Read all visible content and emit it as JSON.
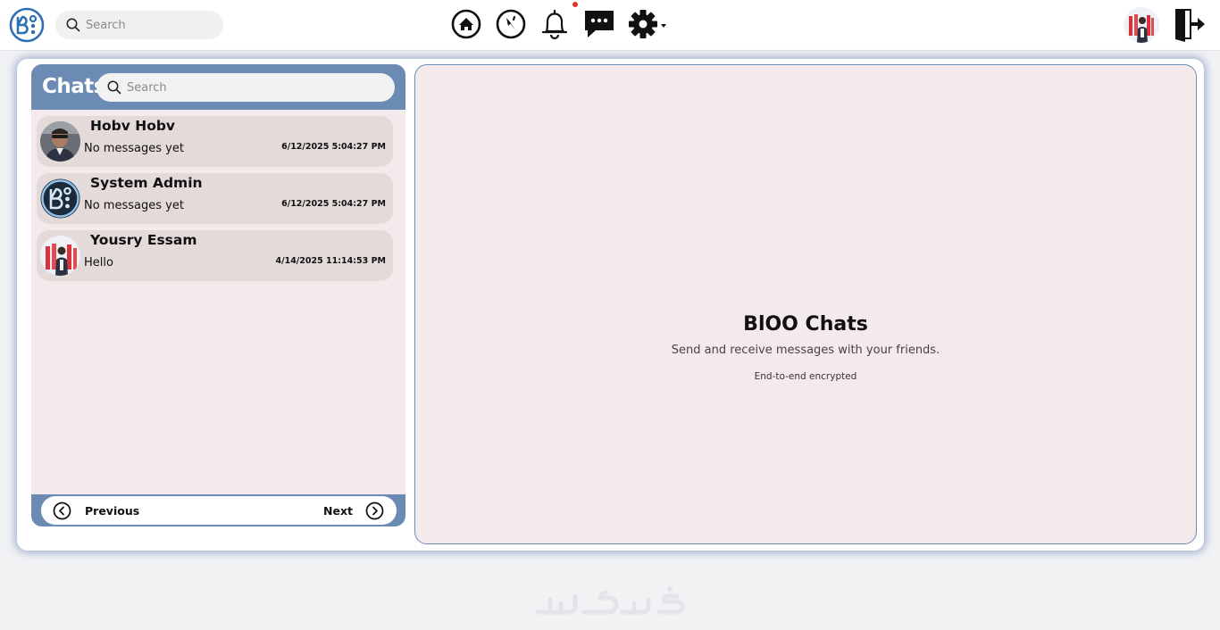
{
  "topbar": {
    "search_placeholder": "Search",
    "icons": [
      "logo-icon",
      "search-icon",
      "home-icon",
      "compass-icon",
      "bell-icon",
      "chat-icon",
      "gear-icon",
      "logout-icon"
    ],
    "notification_dot_color": "#e0342c"
  },
  "chats": {
    "title": "Chats",
    "search_placeholder": "Search",
    "items": [
      {
        "name": "Hobv Hobv",
        "last_message": "No messages yet",
        "time": "6/12/2025 5:04:27 PM",
        "avatar": "photo"
      },
      {
        "name": "System Admin",
        "last_message": "No messages yet",
        "time": "6/12/2025 5:04:27 PM",
        "avatar": "logo"
      },
      {
        "name": "Yousry Essam",
        "last_message": "Hello",
        "time": "4/14/2025 11:14:53 PM",
        "avatar": "photo"
      }
    ],
    "pagination": {
      "prev_label": "Previous",
      "next_label": "Next"
    }
  },
  "conversation": {
    "title": "BlOO Chats",
    "subtitle": "Send and receive messages with your friends.",
    "encryption_note": "End-to-end encrypted"
  },
  "colors": {
    "accent": "#6c8bb4",
    "panel_bg": "#f5eaeb",
    "chat_item_bg": "#e3dad9",
    "brand_blue": "#2f6fb5"
  }
}
